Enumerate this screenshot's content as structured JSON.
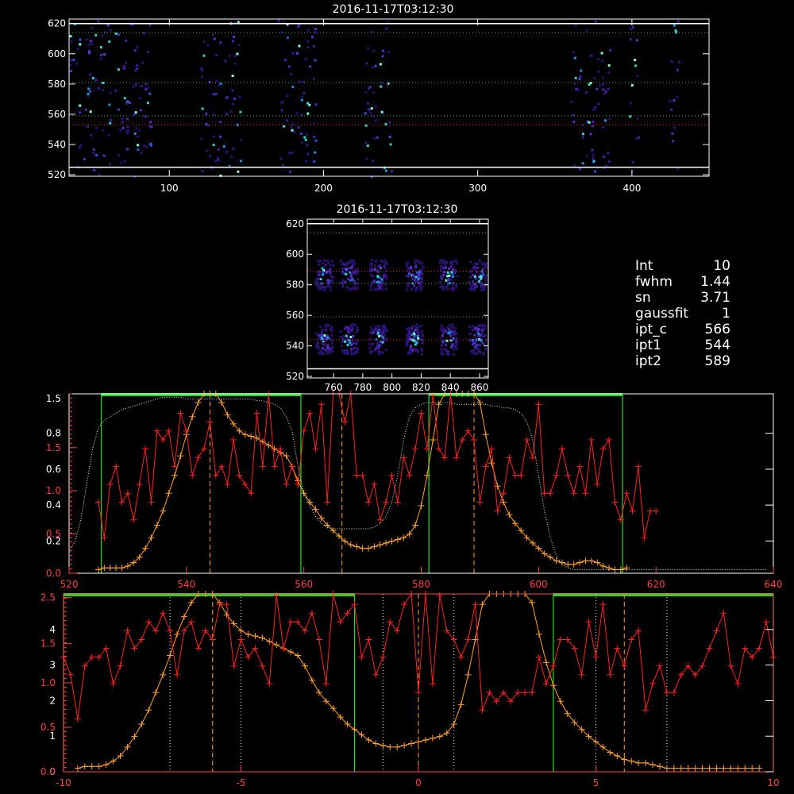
{
  "titles": {
    "panel1": "2016-11-17T03:12:30",
    "panel2": "2016-11-17T03:12:30"
  },
  "info": [
    {
      "label": "Int",
      "value": "10"
    },
    {
      "label": "fwhm",
      "value": "1.44"
    },
    {
      "label": "sn",
      "value": "3.71"
    },
    {
      "label": "gaussfit",
      "value": "1"
    },
    {
      "label": "ipt_c",
      "value": "566"
    },
    {
      "label": "ipt1",
      "value": "544"
    },
    {
      "label": "ipt2",
      "value": "589"
    }
  ],
  "chart_data": [
    {
      "type": "heatmap",
      "title": "2016-11-17T03:12:30",
      "xlim": [
        35,
        450
      ],
      "ylim": [
        519,
        623
      ],
      "xticks": [
        100,
        200,
        300,
        400
      ],
      "yticks": [
        520,
        540,
        560,
        580,
        600,
        620
      ],
      "column_bands": [
        [
          35,
          88
        ],
        [
          120,
          146
        ],
        [
          170,
          196
        ],
        [
          226,
          244
        ],
        [
          360,
          386
        ],
        [
          398,
          404
        ],
        [
          424,
          430
        ]
      ],
      "hlines_white": [
        620,
        525
      ],
      "hlines_green": [
        614,
        581,
        559
      ],
      "hlines_red": [
        553
      ]
    },
    {
      "type": "heatmap",
      "title": "2016-11-17T03:12:30",
      "xlim": [
        742,
        866
      ],
      "ylim": [
        519,
        623
      ],
      "xticks": [
        760,
        780,
        800,
        820,
        840,
        860
      ],
      "yticks": [
        520,
        540,
        560,
        580,
        600,
        620
      ],
      "blobs": [
        [
          753,
          587
        ],
        [
          770,
          587
        ],
        [
          790,
          587
        ],
        [
          815,
          587
        ],
        [
          838,
          587
        ],
        [
          858,
          587
        ],
        [
          753,
          545
        ],
        [
          770,
          545
        ],
        [
          790,
          545
        ],
        [
          815,
          545
        ],
        [
          838,
          545
        ],
        [
          858,
          545
        ]
      ],
      "hlines_white": [
        620,
        525
      ],
      "hlines_green": [
        614,
        581,
        559
      ],
      "hlines_red": [
        589,
        544
      ]
    },
    {
      "type": "line",
      "xlim": [
        520,
        640
      ],
      "xticks": [
        520,
        540,
        560,
        580,
        600,
        620,
        640
      ],
      "yticks_white": [
        "0.2",
        "0.4",
        "0.6",
        "0.8"
      ],
      "yticks_red": [
        "0.0",
        "0.5",
        "1.0",
        "1.5"
      ],
      "yticks_white_extra": [
        "1.5"
      ],
      "yticks_orange": [
        "0.0",
        "0.5",
        "1.0",
        "1.5"
      ],
      "green_windows": [
        [
          525.5,
          559.5
        ],
        [
          581.3,
          614.3
        ]
      ],
      "vlines_orange_dashed": [
        544,
        566.5,
        589
      ],
      "series": [
        {
          "color": "#ffa030",
          "x_start": 525,
          "x_step": 1,
          "values": [
            0.02,
            0.03,
            0.03,
            0.03,
            0.03,
            0.04,
            0.06,
            0.09,
            0.14,
            0.2,
            0.27,
            0.35,
            0.45,
            0.55,
            0.66,
            0.78,
            0.88,
            0.96,
            1.02,
            1.05,
            1.02,
            0.96,
            0.89,
            0.84,
            0.8,
            0.78,
            0.77,
            0.76,
            0.74,
            0.72,
            0.7,
            0.68,
            0.66,
            0.6,
            0.52,
            0.45,
            0.4,
            0.36,
            0.31,
            0.27,
            0.24,
            0.21,
            0.18,
            0.16,
            0.15,
            0.14,
            0.14,
            0.15,
            0.16,
            0.17,
            0.18,
            0.19,
            0.2,
            0.22,
            0.27,
            0.38,
            0.55,
            0.75,
            0.95,
            1.12,
            1.22,
            1.25,
            1.25,
            1.22,
            1.12,
            0.96,
            0.78,
            0.62,
            0.49,
            0.4,
            0.33,
            0.28,
            0.24,
            0.2,
            0.17,
            0.14,
            0.11,
            0.09,
            0.07,
            0.06,
            0.05,
            0.05,
            0.06,
            0.07,
            0.07,
            0.06,
            0.04,
            0.03,
            0.02,
            0.02,
            0.03
          ]
        },
        {
          "color": "#ff2020",
          "x_start": 525,
          "x_step": 1,
          "values": [
            0.4,
            0.2,
            0.5,
            0.6,
            0.4,
            0.45,
            0.3,
            0.5,
            0.7,
            0.4,
            0.8,
            0.75,
            0.8,
            0.6,
            0.9,
            0.8,
            0.55,
            0.65,
            0.7,
            0.85,
            0.55,
            0.6,
            0.5,
            0.75,
            0.55,
            0.5,
            0.45,
            0.9,
            0.6,
            1.45,
            0.6,
            0.7,
            0.5,
            0.6,
            0.5,
            0.8,
            0.9,
            0.7,
            0.95,
            0.4,
            1.05,
            1.15,
            0.85,
            1.15,
            0.55,
            0.55,
            0.4,
            0.5,
            0.3,
            0.4,
            0.55,
            0.4,
            0.65,
            0.55,
            0.7,
            0.9,
            0.7,
            1.0,
            0.7,
            0.65,
            1.05,
            0.65,
            0.75,
            0.8,
            0.75,
            0.4,
            0.6,
            0.7,
            0.35,
            0.45,
            0.65,
            0.55,
            0.55,
            0.75,
            0.65,
            0.95,
            0.45,
            0.45,
            0.55,
            0.7,
            0.55,
            0.45,
            0.6,
            0.45,
            0.75,
            0.5,
            0.7,
            0.75,
            0.4,
            0.3,
            0.45,
            0.35,
            0.6,
            0.2,
            0.35,
            0.35
          ]
        },
        {
          "color": "#d8ffd8",
          "dotted": true,
          "x_start": 520,
          "x_step": 1,
          "values": [
            0.12,
            0.18,
            0.3,
            0.5,
            0.7,
            0.82,
            0.86,
            0.88,
            0.9,
            0.92,
            0.93,
            0.94,
            0.95,
            0.96,
            0.97,
            0.98,
            0.99,
            0.99,
            0.99,
            0.99,
            0.98,
            0.98,
            0.98,
            0.98,
            0.98,
            0.98,
            0.98,
            0.98,
            0.98,
            0.98,
            0.98,
            0.98,
            0.97,
            0.97,
            0.96,
            0.95,
            0.93,
            0.88,
            0.8,
            0.6,
            0.45,
            0.38,
            0.32,
            0.28,
            0.26,
            0.25,
            0.25,
            0.25,
            0.25,
            0.25,
            0.25,
            0.25,
            0.26,
            0.28,
            0.32,
            0.4,
            0.55,
            0.75,
            0.88,
            0.93,
            0.95,
            0.96,
            0.96,
            0.96,
            0.96,
            0.96,
            0.95,
            0.95,
            0.95,
            0.95,
            0.95,
            0.95,
            0.94,
            0.94,
            0.93,
            0.93,
            0.92,
            0.9,
            0.85,
            0.75,
            0.55,
            0.35,
            0.2,
            0.1,
            0.05,
            0.03,
            0.02,
            0.02,
            0.02,
            0.02,
            0.02,
            0.02,
            0.02,
            0.02,
            0.02,
            0.02,
            0.02,
            0.02,
            0.02,
            0.02,
            0.02,
            0.02,
            0.02,
            0.02,
            0.02,
            0.02,
            0.02,
            0.02,
            0.02,
            0.02,
            0.02,
            0.02,
            0.02,
            0.02,
            0.02,
            0.02,
            0.02,
            0.02,
            0.02,
            0.02
          ]
        }
      ]
    },
    {
      "type": "line",
      "xlim": [
        -10,
        10
      ],
      "xticks": [
        -10,
        -5,
        0,
        5,
        10
      ],
      "yticks_white": [
        "0",
        "1",
        "2",
        "3",
        "4"
      ],
      "yticks_red": [
        "0.0",
        "0.5",
        "1.0",
        "1.5",
        "2.5"
      ],
      "green_windows": [
        [
          -10,
          -1.8
        ],
        [
          3.8,
          10
        ]
      ],
      "vlines_orange_dashed": [
        -5.8,
        0,
        5.8
      ],
      "vlines_white_dotted": [
        -7,
        -5,
        -1,
        1,
        5,
        7
      ],
      "series": [
        {
          "color": "#ffa030",
          "x_start": -9.6,
          "x_step": 0.2,
          "values": [
            0.02,
            0.03,
            0.03,
            0.03,
            0.04,
            0.06,
            0.09,
            0.14,
            0.2,
            0.27,
            0.35,
            0.45,
            0.55,
            0.66,
            0.78,
            0.88,
            0.96,
            1.02,
            1.05,
            1.02,
            0.96,
            0.89,
            0.84,
            0.8,
            0.78,
            0.77,
            0.76,
            0.74,
            0.72,
            0.7,
            0.68,
            0.66,
            0.6,
            0.52,
            0.45,
            0.4,
            0.36,
            0.31,
            0.27,
            0.24,
            0.21,
            0.18,
            0.16,
            0.15,
            0.14,
            0.14,
            0.15,
            0.16,
            0.17,
            0.18,
            0.19,
            0.2,
            0.22,
            0.27,
            0.38,
            0.55,
            0.75,
            0.95,
            1.12,
            1.22,
            1.25,
            1.25,
            1.22,
            1.12,
            0.96,
            0.78,
            0.62,
            0.49,
            0.4,
            0.33,
            0.28,
            0.24,
            0.2,
            0.17,
            0.14,
            0.11,
            0.09,
            0.07,
            0.06,
            0.05,
            0.05,
            0.04,
            0.03,
            0.02,
            0.02,
            0.02,
            0.02,
            0.02,
            0.02,
            0.02,
            0.02,
            0.02,
            0.02,
            0.02,
            0.02,
            0.02,
            0.02
          ]
        },
        {
          "color": "#ff2020",
          "x_start": -10,
          "x_step": 0.2,
          "values": [
            0.65,
            0.55,
            0.3,
            0.6,
            0.65,
            0.65,
            0.7,
            0.5,
            0.6,
            0.8,
            0.7,
            0.75,
            0.85,
            0.8,
            0.9,
            0.8,
            0.55,
            0.8,
            0.85,
            0.7,
            0.8,
            0.75,
            0.95,
            0.95,
            0.6,
            0.75,
            0.65,
            0.7,
            0.6,
            0.5,
            1.0,
            0.7,
            0.85,
            0.85,
            0.8,
            0.9,
            0.75,
            0.5,
            1.05,
            0.85,
            0.9,
            0.95,
            0.65,
            0.75,
            0.55,
            0.65,
            0.85,
            0.8,
            0.95,
            1.15,
            0.45,
            1.25,
            0.5,
            1.0,
            0.8,
            0.75,
            0.65,
            0.75,
            0.95,
            0.35,
            0.45,
            0.4,
            0.45,
            0.4,
            0.45,
            0.45,
            0.45,
            0.65,
            0.5,
            0.6,
            0.75,
            0.75,
            0.7,
            0.55,
            0.85,
            0.65,
            0.95,
            0.55,
            0.7,
            0.6,
            0.75,
            0.8,
            0.35,
            0.5,
            0.6,
            0.45,
            0.45,
            0.55,
            0.6,
            0.55,
            0.6,
            0.7,
            0.8,
            0.9,
            0.6,
            0.5,
            0.7,
            0.65,
            0.7,
            0.85,
            0.65,
            0.45
          ]
        }
      ]
    }
  ]
}
